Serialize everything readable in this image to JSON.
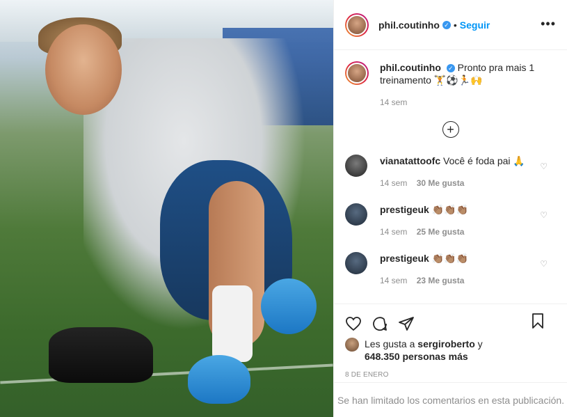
{
  "post": {
    "username": "phil.coutinho",
    "follow_label": "Seguir",
    "more_label": "•••",
    "verified_mark": "✓"
  },
  "caption": {
    "username": "phil.coutinho",
    "text": "Pronto pra mais 1 treinamento 🏋⚽🏃🙌",
    "time": "14 sem"
  },
  "comments": [
    {
      "username": "vianatattoofc",
      "text": "Você é foda pai 🙏",
      "time": "14 sem",
      "likes": "30 Me gusta"
    },
    {
      "username": "prestigeuk",
      "text": "👏🏽👏🏽👏🏽",
      "time": "14 sem",
      "likes": "25 Me gusta"
    },
    {
      "username": "prestigeuk",
      "text": "👏🏽👏🏽👏🏽",
      "time": "14 sem",
      "likes": "23 Me gusta"
    }
  ],
  "likes_line": {
    "prefix": "Les gusta a",
    "user": "sergiroberto",
    "conj": "y",
    "count": "648.350 personas más"
  },
  "date": "8 DE ENERO",
  "comments_limited": "Se han limitado los comentarios en esta publicación.",
  "icons": {
    "heart": "heart-icon",
    "comment": "comment-icon",
    "share": "share-icon",
    "save": "bookmark-icon",
    "add": "plus-circle-icon"
  },
  "colors": {
    "link": "#0095f6",
    "verified": "#3897f0",
    "muted": "#8e8e8e"
  }
}
